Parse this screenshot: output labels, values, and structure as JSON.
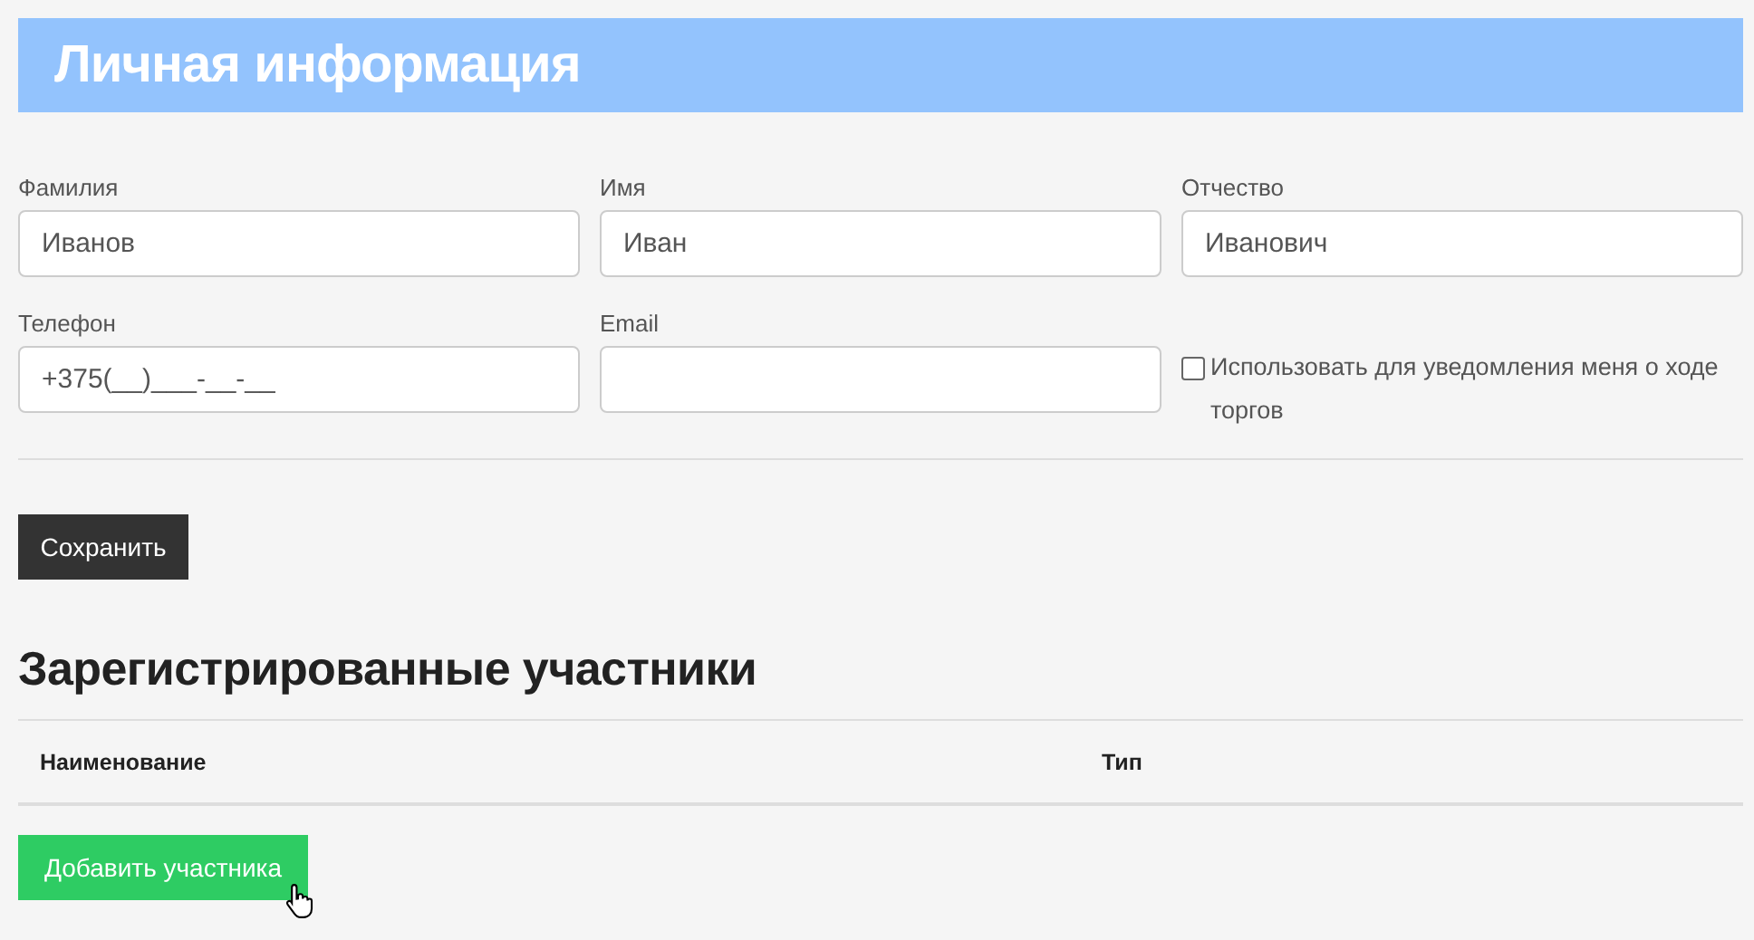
{
  "title": "Личная информация",
  "fields": [
    {
      "label": "Фамилия",
      "value": "Иванов"
    },
    {
      "label": "Имя",
      "value": "Иван"
    },
    {
      "label": "Отчество",
      "value": "Иванович"
    },
    {
      "label": "Телефон",
      "value": "+375(__)___-__-__"
    },
    {
      "label": "Email"
    }
  ],
  "notify_checkbox": {
    "label": "Использовать для уведомления меня о ходе торгов",
    "checked": false
  },
  "save_button": "Сохранить",
  "participants": {
    "heading": "Зарегистрированные участники",
    "columns": [
      "Наименование",
      "Тип"
    ]
  },
  "add_button": "Добавить участника"
}
